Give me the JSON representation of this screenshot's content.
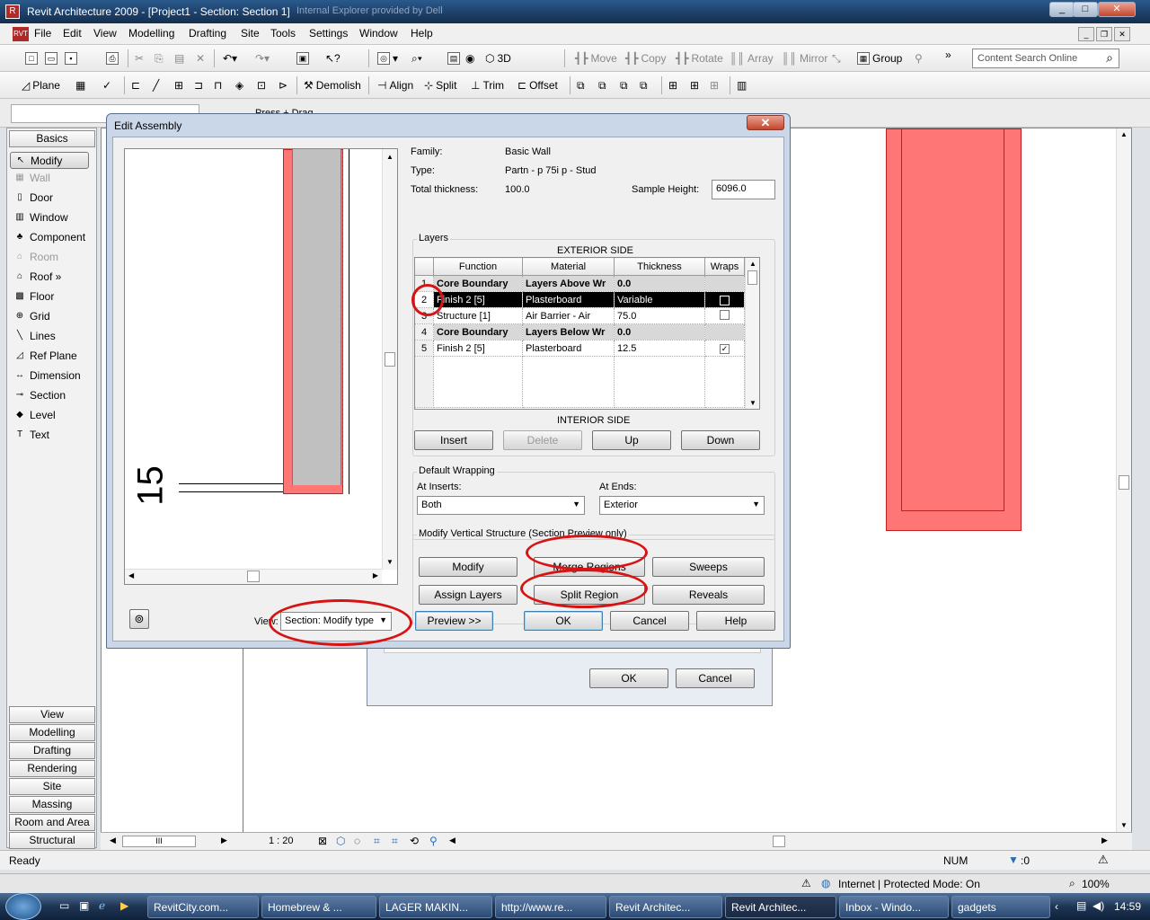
{
  "window": {
    "title": "Revit Architecture 2009 - [Project1 - Section: Section 1]",
    "overlay_text": "Internal Explorer provided by Dell",
    "controls": [
      "_",
      "□",
      "✕"
    ]
  },
  "menu": [
    "File",
    "Edit",
    "View",
    "Modelling",
    "Drafting",
    "Site",
    "Tools",
    "Settings",
    "Window",
    "Help"
  ],
  "toolbar1": {
    "label_3d": "3D",
    "move": "Move",
    "copy": "Copy",
    "rotate": "Rotate",
    "array": "Array",
    "mirror": "Mirror",
    "group": "Group",
    "search_placeholder": "Content Search Online"
  },
  "toolbar2": {
    "plane": "Plane",
    "demolish": "Demolish",
    "align": "Align",
    "split": "Split",
    "trim": "Trim",
    "offset": "Offset"
  },
  "options_bar": {
    "press_drag": "Press + Drag"
  },
  "design_bar": {
    "top_tab": "Basics",
    "items": [
      {
        "label": "Modify",
        "icon": "arrow-icon",
        "glyph": "↖",
        "enabled": true,
        "selected": true
      },
      {
        "label": "Wall",
        "icon": "wall-icon",
        "glyph": "▦",
        "enabled": false
      },
      {
        "label": "Door",
        "icon": "door-icon",
        "glyph": "▯",
        "enabled": true
      },
      {
        "label": "Window",
        "icon": "window-icon",
        "glyph": "▥",
        "enabled": true
      },
      {
        "label": "Component",
        "icon": "component-icon",
        "glyph": "♣",
        "enabled": true
      },
      {
        "label": "Room",
        "icon": "room-icon",
        "glyph": "⌂",
        "enabled": false
      },
      {
        "label": "Roof »",
        "icon": "roof-icon",
        "glyph": "⌂",
        "enabled": true
      },
      {
        "label": "Floor",
        "icon": "floor-icon",
        "glyph": "▩",
        "enabled": true
      },
      {
        "label": "Grid",
        "icon": "grid-icon",
        "glyph": "⊕",
        "enabled": true
      },
      {
        "label": "Lines",
        "icon": "lines-icon",
        "glyph": "╲",
        "enabled": true
      },
      {
        "label": "Ref Plane",
        "icon": "ref-plane-icon",
        "glyph": "◿",
        "enabled": true
      },
      {
        "label": "Dimension",
        "icon": "dimension-icon",
        "glyph": "↔",
        "enabled": true
      },
      {
        "label": "Section",
        "icon": "section-icon",
        "glyph": "⊸",
        "enabled": true
      },
      {
        "label": "Level",
        "icon": "level-icon",
        "glyph": "◆",
        "enabled": true
      },
      {
        "label": "Text",
        "icon": "text-icon",
        "glyph": "T",
        "enabled": true
      }
    ],
    "bottom_tabs": [
      "View",
      "Modelling",
      "Drafting",
      "Rendering",
      "Site",
      "Massing",
      "Room and Area",
      "Structural"
    ]
  },
  "view_control": {
    "scale": "1 : 20"
  },
  "status": {
    "text": "Ready",
    "num": "NUM",
    "filter": ":0"
  },
  "ie_status": {
    "zone": "Internet | Protected Mode: On",
    "zoom": "100%"
  },
  "taskbar": {
    "tasks": [
      "RevitCity.com...",
      "Homebrew & ...",
      "LAGER MAKIN...",
      "http://www.re...",
      "Revit Architec...",
      "Revit Architec...",
      "Inbox - Windo...",
      "gadgets"
    ],
    "active_index": 5,
    "clock": "14:59"
  },
  "bg_dialog": {
    "ok": "OK",
    "cancel": "Cancel"
  },
  "dialog": {
    "title": "Edit Assembly",
    "family_label": "Family:",
    "family_value": "Basic Wall",
    "type_label": "Type:",
    "type_value": "Partn - p 75i p - Stud",
    "thickness_label": "Total thickness:",
    "thickness_value": "100.0",
    "sample_height_label": "Sample Height:",
    "sample_height_value": "6096.0",
    "layers_group": "Layers",
    "exterior_side": "EXTERIOR SIDE",
    "interior_side": "INTERIOR SIDE",
    "columns": [
      "Function",
      "Material",
      "Thickness",
      "Wraps"
    ],
    "rows": [
      {
        "num": "1",
        "function": "Core Boundary",
        "material": "Layers Above Wr",
        "thickness": "0.0",
        "wraps": "",
        "kind": "core"
      },
      {
        "num": "2",
        "function": "Finish 2 [5]",
        "material": "Plasterboard",
        "thickness": "Variable",
        "wraps": "■",
        "kind": "sel"
      },
      {
        "num": "3",
        "function": "Structure [1]",
        "material": "Air Barrier - Air",
        "thickness": "75.0",
        "wraps": "",
        "kind": "normal"
      },
      {
        "num": "4",
        "function": "Core Boundary",
        "material": "Layers Below Wr",
        "thickness": "0.0",
        "wraps": "",
        "kind": "core"
      },
      {
        "num": "5",
        "function": "Finish 2 [5]",
        "material": "Plasterboard",
        "thickness": "12.5",
        "wraps": "✓",
        "kind": "normal"
      }
    ],
    "buttons": {
      "insert": "Insert",
      "delete": "Delete",
      "up": "Up",
      "down": "Down",
      "modify": "Modify",
      "merge": "Merge Regions",
      "sweeps": "Sweeps",
      "assign": "Assign Layers",
      "split": "Split Region",
      "reveals": "Reveals",
      "preview": "Preview >>",
      "ok": "OK",
      "cancel": "Cancel",
      "help": "Help"
    },
    "wrapping_group": "Default Wrapping",
    "at_inserts_label": "At Inserts:",
    "at_inserts_value": "Both",
    "at_ends_label": "At Ends:",
    "at_ends_value": "Exterior",
    "vertical_group": "Modify Vertical Structure (Section Preview only)",
    "view_label": "View:",
    "view_value": "Section: Modify type",
    "preview_dim": "15"
  },
  "annotation_color": "#d81313",
  "wall_color": "#ff7676"
}
